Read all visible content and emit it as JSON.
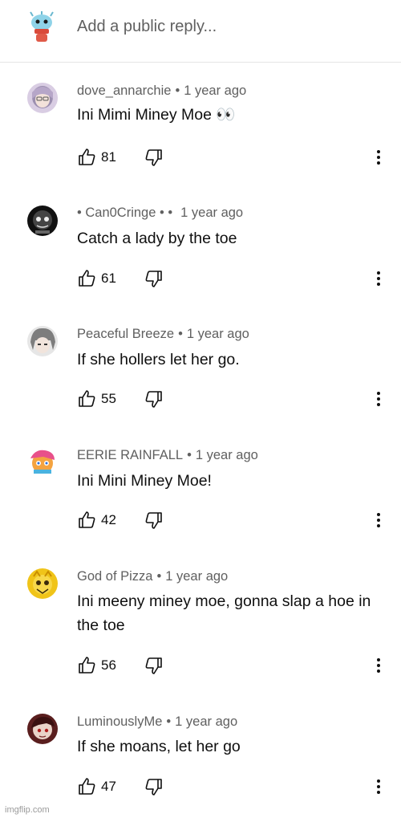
{
  "reply_box": {
    "placeholder": "Add a public reply..."
  },
  "comments": [
    {
      "author": "dove_annarchie",
      "separator": "•",
      "time": "1 year ago",
      "text": "Ini Mimi Miney Moe 👀",
      "likes": "81",
      "avatar_color": "#b9a8c9"
    },
    {
      "author": "• Can0Cringe • •",
      "separator": "",
      "time": "1 year ago",
      "text": "Catch a lady by the toe",
      "likes": "61",
      "avatar_color": "#1a1a1a"
    },
    {
      "author": "Peaceful Breeze",
      "separator": "•",
      "time": "1 year ago",
      "text": "If she hollers let her go.",
      "likes": "55",
      "avatar_color": "#8c8c8c"
    },
    {
      "author": "EERIE RAINFALL",
      "separator": "•",
      "time": "1 year ago",
      "text": "Ini Mini Miney Moe!",
      "likes": "42",
      "avatar_color": "#e8508a"
    },
    {
      "author": "God of Pizza",
      "separator": "•",
      "time": "1 year ago",
      "text": "Ini meeny miney moe, gonna slap a hoe in the toe",
      "likes": "56",
      "avatar_color": "#f0c419"
    },
    {
      "author": "LuminouslyMe",
      "separator": "•",
      "time": "1 year ago",
      "text": "If she moans, let her go",
      "likes": "47",
      "avatar_color": "#7a2a2a"
    }
  ],
  "icons": {
    "like": "thumbs-up-icon",
    "dislike": "thumbs-down-icon",
    "more": "vertical-dots-icon"
  },
  "watermark": "imgflip.com"
}
